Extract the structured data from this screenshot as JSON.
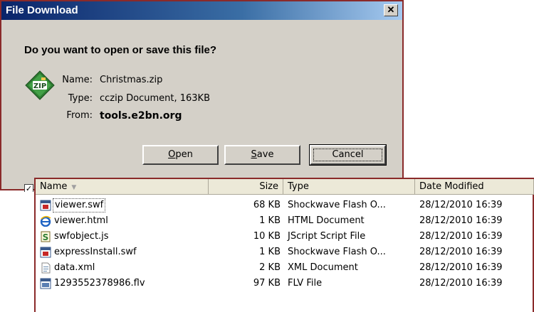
{
  "dialog": {
    "title": "File Download",
    "close_glyph": "✕",
    "question": "Do you want to open or save this file?",
    "icon": "zip-file-icon",
    "fields": [
      {
        "label": "Name:",
        "value": "Christmas.zip"
      },
      {
        "label": "Type:",
        "value": "cczip Document, 163KB"
      },
      {
        "label": "From:",
        "value": "tools.e2bn.org"
      }
    ],
    "buttons": {
      "open": {
        "accel": "O",
        "rest": "pen"
      },
      "save": {
        "accel": "S",
        "rest": "ave"
      },
      "cancel": "Cancel"
    },
    "checkbox_checked": true,
    "colors": {
      "titlebar": "#0a246a",
      "face": "#d4d0c8",
      "frame": "#8a2a2a"
    }
  },
  "filelist": {
    "columns": {
      "name": "Name",
      "size": "Size",
      "type": "Type",
      "date": "Date Modified"
    },
    "sort_indicator": "▼",
    "rows": [
      {
        "icon": "flash-file-icon",
        "name": "viewer.swf",
        "size": "68 KB",
        "type": "Shockwave Flash O...",
        "date": "28/12/2010 16:39",
        "selected": true
      },
      {
        "icon": "ie-html-icon",
        "name": "viewer.html",
        "size": "1 KB",
        "type": "HTML Document",
        "date": "28/12/2010 16:39"
      },
      {
        "icon": "script-file-icon",
        "name": "swfobject.js",
        "size": "10 KB",
        "type": "JScript Script File",
        "date": "28/12/2010 16:39"
      },
      {
        "icon": "flash-file-icon",
        "name": "expressInstall.swf",
        "size": "1 KB",
        "type": "Shockwave Flash O...",
        "date": "28/12/2010 16:39"
      },
      {
        "icon": "xml-file-icon",
        "name": "data.xml",
        "size": "2 KB",
        "type": "XML Document",
        "date": "28/12/2010 16:39"
      },
      {
        "icon": "video-file-icon",
        "name": "1293552378986.flv",
        "size": "97 KB",
        "type": "FLV File",
        "date": "28/12/2010 16:39"
      }
    ]
  }
}
